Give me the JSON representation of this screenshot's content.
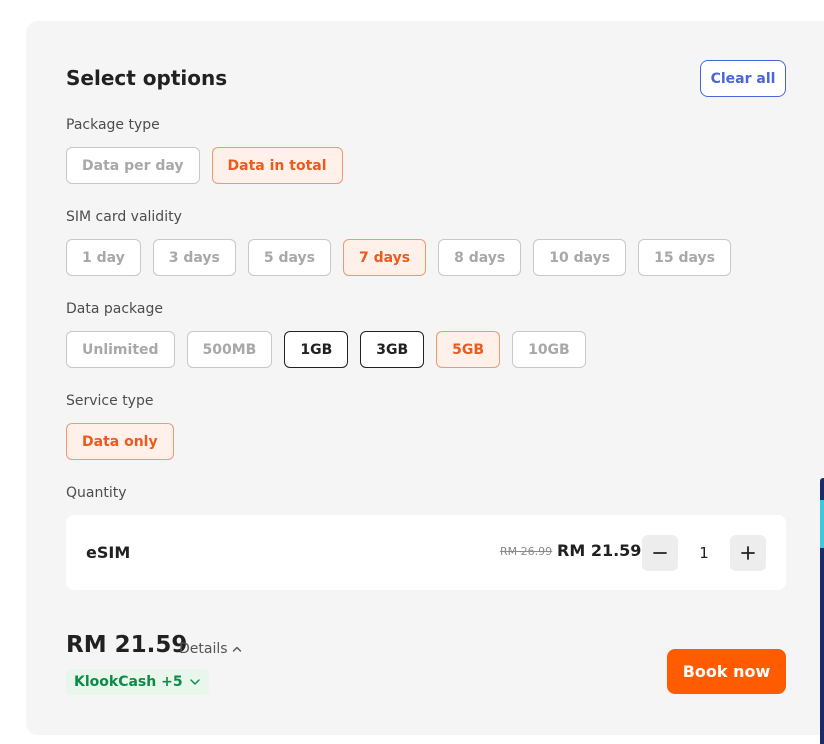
{
  "header": {
    "title": "Select options",
    "clear_label": "Clear all"
  },
  "colors": {
    "accent": "#ff5b00",
    "selected_text": "#eb5a1e",
    "link": "#4a65d8",
    "klookcash": "#0a8c46"
  },
  "package_type": {
    "label": "Package type",
    "options": [
      {
        "label": "Data per day",
        "state": "disabled"
      },
      {
        "label": "Data in total",
        "state": "selected"
      }
    ]
  },
  "validity": {
    "label": "SIM card validity",
    "options": [
      {
        "label": "1 day",
        "state": "disabled"
      },
      {
        "label": "3 days",
        "state": "disabled"
      },
      {
        "label": "5 days",
        "state": "disabled"
      },
      {
        "label": "7 days",
        "state": "selected"
      },
      {
        "label": "8 days",
        "state": "disabled"
      },
      {
        "label": "10 days",
        "state": "disabled"
      },
      {
        "label": "15 days",
        "state": "disabled"
      }
    ]
  },
  "data_package": {
    "label": "Data package",
    "options": [
      {
        "label": "Unlimited",
        "state": "disabled"
      },
      {
        "label": "500MB",
        "state": "disabled"
      },
      {
        "label": "1GB",
        "state": "available"
      },
      {
        "label": "3GB",
        "state": "available"
      },
      {
        "label": "5GB",
        "state": "selected"
      },
      {
        "label": "10GB",
        "state": "disabled"
      }
    ]
  },
  "service_type": {
    "label": "Service type",
    "options": [
      {
        "label": "Data only",
        "state": "selected"
      }
    ]
  },
  "quantity": {
    "label": "Quantity",
    "item_name": "eSIM",
    "original_price": "RM 26.99",
    "price": "RM 21.59",
    "value": "1",
    "decrement_icon": "minus-icon",
    "increment_icon": "plus-icon"
  },
  "footer": {
    "total": "RM 21.59",
    "details_label": "Details",
    "details_icon": "chevron-up-icon",
    "klookcash_label": "KlookCash +5",
    "klookcash_icon": "chevron-down-icon",
    "book_label": "Book now"
  }
}
